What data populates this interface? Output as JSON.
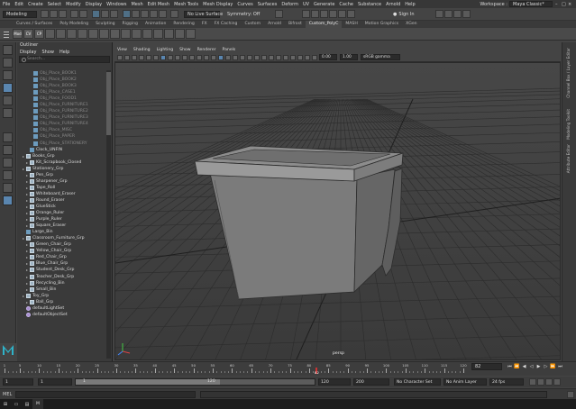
{
  "menubar": [
    "File",
    "Edit",
    "Create",
    "Select",
    "Modify",
    "Display",
    "Windows",
    "Mesh",
    "Edit Mesh",
    "Mesh Tools",
    "Mesh Display",
    "Curves",
    "Surfaces",
    "Deform",
    "UV",
    "Generate",
    "Cache",
    "Substance",
    "Arnold",
    "Help"
  ],
  "workspace": {
    "label": "Workspace :",
    "value": "Maya Classic*"
  },
  "mode_menu": "Modeling",
  "live_surface": "No Live Surface",
  "symmetry": "Symmetry: Off",
  "sign_in": "Sign In",
  "shelf_tabs": [
    "Curves / Surfaces",
    "Poly Modeling",
    "Sculpting",
    "Rigging",
    "Animation",
    "Rendering",
    "FX",
    "FX Caching",
    "Custom",
    "Arnold",
    "Bifrost",
    "Custom_PolyC",
    "MASH",
    "Motion Graphics",
    "XGen"
  ],
  "shelf_active_tab": "Custom_PolyC",
  "shelf_icons": [
    {
      "label": "Mod",
      "color": "b"
    },
    {
      "label": "CV",
      "color": "w"
    },
    {
      "label": "CP",
      "color": ""
    },
    {
      "label": "",
      "color": "o"
    },
    {
      "label": "",
      "color": "o"
    },
    {
      "label": "",
      "color": "b"
    },
    {
      "label": "",
      "color": "b"
    },
    {
      "label": "",
      "color": "o"
    },
    {
      "label": "",
      "color": "o"
    },
    {
      "label": "",
      "color": "g"
    },
    {
      "label": "",
      "color": ""
    },
    {
      "label": "",
      "color": "g"
    },
    {
      "label": "",
      "color": "b"
    },
    {
      "label": "",
      "color": ""
    },
    {
      "label": "",
      "color": "b"
    },
    {
      "label": "",
      "color": ""
    },
    {
      "label": "",
      "color": ""
    }
  ],
  "outliner": {
    "title": "Outliner",
    "menu": [
      "Display",
      "Show",
      "Help"
    ],
    "search_placeholder": "Search...",
    "items": [
      {
        "label": "Obj_Place_BOOK1",
        "style": "dim",
        "indent": 3,
        "icon": "mesh"
      },
      {
        "label": "Obj_Place_BOOK2",
        "style": "dim",
        "indent": 3,
        "icon": "mesh"
      },
      {
        "label": "Obj_Place_BOOK3",
        "style": "dim",
        "indent": 3,
        "icon": "mesh"
      },
      {
        "label": "Obj_Place_CASE1",
        "style": "dim",
        "indent": 3,
        "icon": "mesh"
      },
      {
        "label": "Obj_Place_FOOD1",
        "style": "dim",
        "indent": 3,
        "icon": "mesh"
      },
      {
        "label": "Obj_Place_FURNITURE1",
        "style": "dim",
        "indent": 3,
        "icon": "mesh"
      },
      {
        "label": "Obj_Place_FURNITURE2",
        "style": "dim",
        "indent": 3,
        "icon": "mesh"
      },
      {
        "label": "Obj_Place_FURNITURE3",
        "style": "dim",
        "indent": 3,
        "icon": "mesh"
      },
      {
        "label": "Obj_Place_FURNITURE4",
        "style": "dim",
        "indent": 3,
        "icon": "mesh"
      },
      {
        "label": "Obj_Place_MISC",
        "style": "dim",
        "indent": 3,
        "icon": "mesh"
      },
      {
        "label": "Obj_Place_PAPER",
        "style": "dim",
        "indent": 3,
        "icon": "mesh"
      },
      {
        "label": "Obj_Place_STATIONERY",
        "style": "dim",
        "indent": 3,
        "icon": "mesh"
      },
      {
        "label": "Clock_UNFIN",
        "style": "",
        "indent": 2,
        "icon": "mesh"
      },
      {
        "label": "Books_Grp",
        "style": "",
        "indent": 1,
        "icon": "grp"
      },
      {
        "label": "Kit_Scrapbook_Closed",
        "style": "",
        "indent": 2,
        "icon": "grp"
      },
      {
        "label": "Stationery_Grp",
        "style": "",
        "indent": 1,
        "icon": "grp"
      },
      {
        "label": "Pen_Grp",
        "style": "",
        "indent": 2,
        "icon": "grp"
      },
      {
        "label": "Sharpener_Grp",
        "style": "",
        "indent": 2,
        "icon": "grp"
      },
      {
        "label": "Tape_Roll",
        "style": "",
        "indent": 2,
        "icon": "grp"
      },
      {
        "label": "Whiteboard_Eraser",
        "style": "",
        "indent": 2,
        "icon": "grp"
      },
      {
        "label": "Round_Eraser",
        "style": "",
        "indent": 2,
        "icon": "grp"
      },
      {
        "label": "GlueStick",
        "style": "",
        "indent": 2,
        "icon": "grp"
      },
      {
        "label": "Orange_Ruler",
        "style": "",
        "indent": 2,
        "icon": "grp"
      },
      {
        "label": "Purple_Ruler",
        "style": "",
        "indent": 2,
        "icon": "grp"
      },
      {
        "label": "Square_Eraser",
        "style": "",
        "indent": 2,
        "icon": "grp"
      },
      {
        "label": "Large_Bin",
        "style": "",
        "indent": 1,
        "icon": "mesh"
      },
      {
        "label": "Classroom_Furniture_Grp",
        "style": "",
        "indent": 1,
        "icon": "grp"
      },
      {
        "label": "Green_Chair_Grp",
        "style": "",
        "indent": 2,
        "icon": "grp"
      },
      {
        "label": "Yellow_Chair_Grp",
        "style": "",
        "indent": 2,
        "icon": "grp"
      },
      {
        "label": "Red_Chair_Grp",
        "style": "",
        "indent": 2,
        "icon": "grp"
      },
      {
        "label": "Blue_Chair_Grp",
        "style": "",
        "indent": 2,
        "icon": "grp"
      },
      {
        "label": "Student_Desk_Grp",
        "style": "",
        "indent": 2,
        "icon": "grp"
      },
      {
        "label": "Teacher_Desk_Grp",
        "style": "",
        "indent": 2,
        "icon": "grp"
      },
      {
        "label": "Recycling_Bin",
        "style": "",
        "indent": 2,
        "icon": "grp"
      },
      {
        "label": "Small_Bin",
        "style": "",
        "indent": 2,
        "icon": "grp"
      },
      {
        "label": "Toy_Grp",
        "style": "",
        "indent": 1,
        "icon": "grp"
      },
      {
        "label": "Ball_Grp",
        "style": "",
        "indent": 2,
        "icon": "grp"
      },
      {
        "label": "defaultLightSet",
        "style": "",
        "indent": 1,
        "icon": "set"
      },
      {
        "label": "defaultObjectSet",
        "style": "",
        "indent": 1,
        "icon": "set"
      }
    ]
  },
  "panel_menu": [
    "View",
    "Shading",
    "Lighting",
    "Show",
    "Renderer",
    "Panels"
  ],
  "viewport_fields": {
    "near": "0.00",
    "far": "1.00",
    "colorspace": "sRGB gamma"
  },
  "camera_label": "persp",
  "right_tabs": [
    "Channel Box / Layer Editor",
    "Modeling Toolkit",
    "Attribute Editor"
  ],
  "timeline": {
    "ticks": [
      1,
      5,
      10,
      15,
      20,
      25,
      30,
      35,
      40,
      45,
      50,
      55,
      60,
      65,
      70,
      75,
      80,
      85,
      90,
      95,
      100,
      105,
      110,
      115,
      120
    ],
    "current_frame": 82,
    "end": 120,
    "current_field": "82"
  },
  "range": {
    "start_a": "1",
    "start_b": "1",
    "slider_start": "1",
    "slider_end": "120",
    "end_a": "120",
    "end_b": "200",
    "character_set": "No Character Set",
    "anim_layer": "No Anim Layer",
    "fps": "24 fps"
  },
  "command_line": {
    "lang": "MEL"
  },
  "taskbar": {
    "app": "M"
  }
}
